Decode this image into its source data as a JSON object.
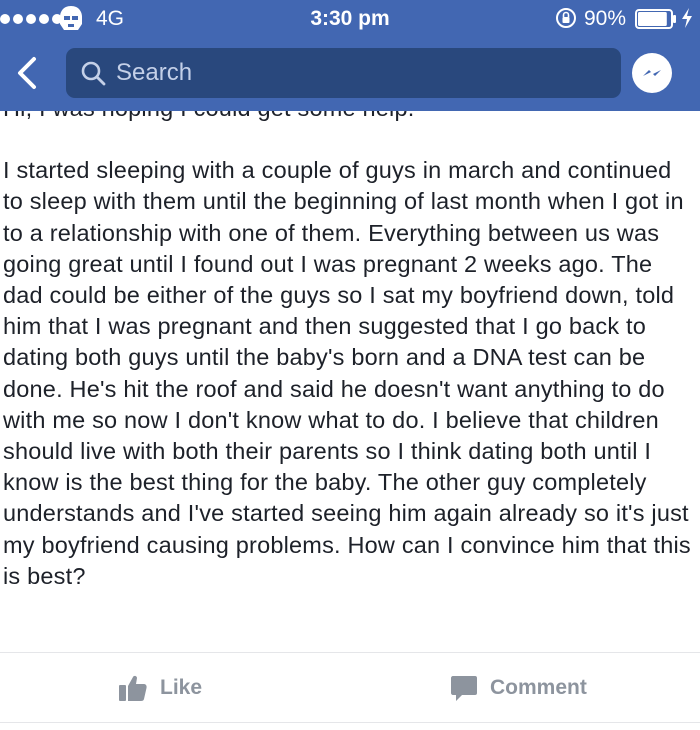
{
  "status_bar": {
    "network": "4G",
    "time": "3:30 pm",
    "battery": "90%",
    "battery_level": 0.9
  },
  "header": {
    "search_placeholder": "Search"
  },
  "post": {
    "greeting": "Hi, I was hoping I could get some help.",
    "body": "I started sleeping with a couple of guys in march and continued to sleep with them until the beginning of last month when I got in to a relationship with one of them. Everything between us was going great until I found out I was pregnant 2 weeks ago. The dad could be either of the guys so I sat my boyfriend down, told him that I was pregnant and then suggested that I go back to dating both guys until the baby's born and a DNA test can be done. He's hit the roof and said he doesn't want anything to do with me so now I don't know what to do. I believe that children should live with both their parents so I think dating both until I know is the best thing for the baby. The other guy completely understands and I've started seeing him again already so it's just my boyfriend causing problems. How can I convince him that this is best?"
  },
  "actions": {
    "like_label": "Like",
    "comment_label": "Comment"
  },
  "icons": {
    "back": "chevron-left-icon",
    "search": "search-icon",
    "messenger": "messenger-icon",
    "like": "thumbs-up-icon",
    "comment": "speech-bubble-icon"
  },
  "colors": {
    "header_blue": "#4267b2",
    "search_bg": "#29487d",
    "action_gray": "#8d949e",
    "text": "#1d2129"
  }
}
